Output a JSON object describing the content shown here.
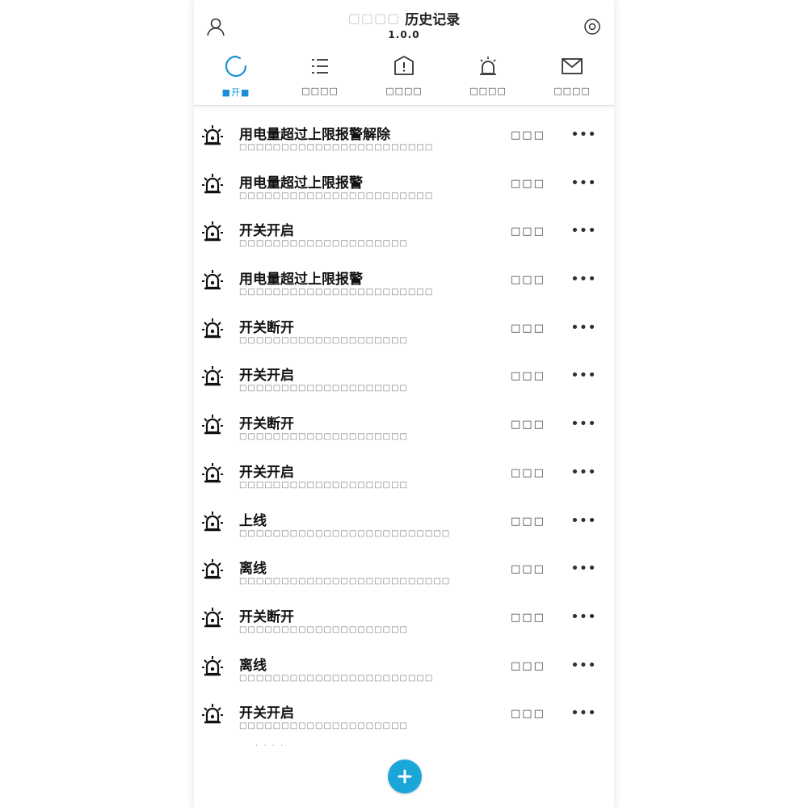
{
  "header": {
    "device_name": "▢▢▢▢",
    "title": "历史记录",
    "subtitle": "1.0.0"
  },
  "tabs": [
    {
      "label": "■开■",
      "icon": "refresh-icon",
      "active": true
    },
    {
      "label": "□□□□",
      "icon": "list-icon",
      "active": false
    },
    {
      "label": "□□□□",
      "icon": "shield-alert-icon",
      "active": false
    },
    {
      "label": "□□□□",
      "icon": "alarm-light-icon",
      "active": false
    },
    {
      "label": "□□□□",
      "icon": "mail-icon",
      "active": false
    }
  ],
  "colors": {
    "accent": "#1a8fd6",
    "add_button": "#1ba6d9"
  },
  "events": [
    {
      "title": "用电量超过上限报警解除",
      "detail": "□□□□□□□□□□□□□□□□□□□□□□□",
      "status": "□□□",
      "more": "•••"
    },
    {
      "title": "用电量超过上限报警",
      "detail": "□□□□□□□□□□□□□□□□□□□□□□□",
      "status": "□□□",
      "more": "•••"
    },
    {
      "title": "开关开启",
      "detail": "□□□□□□□□□□□□□□□□□□□□",
      "status": "□□□",
      "more": "•••"
    },
    {
      "title": "用电量超过上限报警",
      "detail": "□□□□□□□□□□□□□□□□□□□□□□□",
      "status": "□□□",
      "more": "•••"
    },
    {
      "title": "开关断开",
      "detail": "□□□□□□□□□□□□□□□□□□□□",
      "status": "□□□",
      "more": "•••"
    },
    {
      "title": "开关开启",
      "detail": "□□□□□□□□□□□□□□□□□□□□",
      "status": "□□□",
      "more": "•••"
    },
    {
      "title": "开关断开",
      "detail": "□□□□□□□□□□□□□□□□□□□□",
      "status": "□□□",
      "more": "•••"
    },
    {
      "title": "开关开启",
      "detail": "□□□□□□□□□□□□□□□□□□□□",
      "status": "□□□",
      "more": "•••"
    },
    {
      "title": "上线",
      "detail": "□□□□□□□□□□□□□□□□□□□□□□□□□",
      "status": "□□□",
      "more": "•••"
    },
    {
      "title": "离线",
      "detail": "□□□□□□□□□□□□□□□□□□□□□□□□□",
      "status": "□□□",
      "more": "•••"
    },
    {
      "title": "开关断开",
      "detail": "□□□□□□□□□□□□□□□□□□□□",
      "status": "□□□",
      "more": "•••"
    },
    {
      "title": "离线",
      "detail": "□□□□□□□□□□□□□□□□□□□□□□□",
      "status": "□□□",
      "more": "•••"
    },
    {
      "title": "开关开启",
      "detail": "□□□□□□□□□□□□□□□□□□□□",
      "status": "□□□",
      "more": "•••"
    }
  ],
  "footer": {
    "note": "· · · ·"
  }
}
